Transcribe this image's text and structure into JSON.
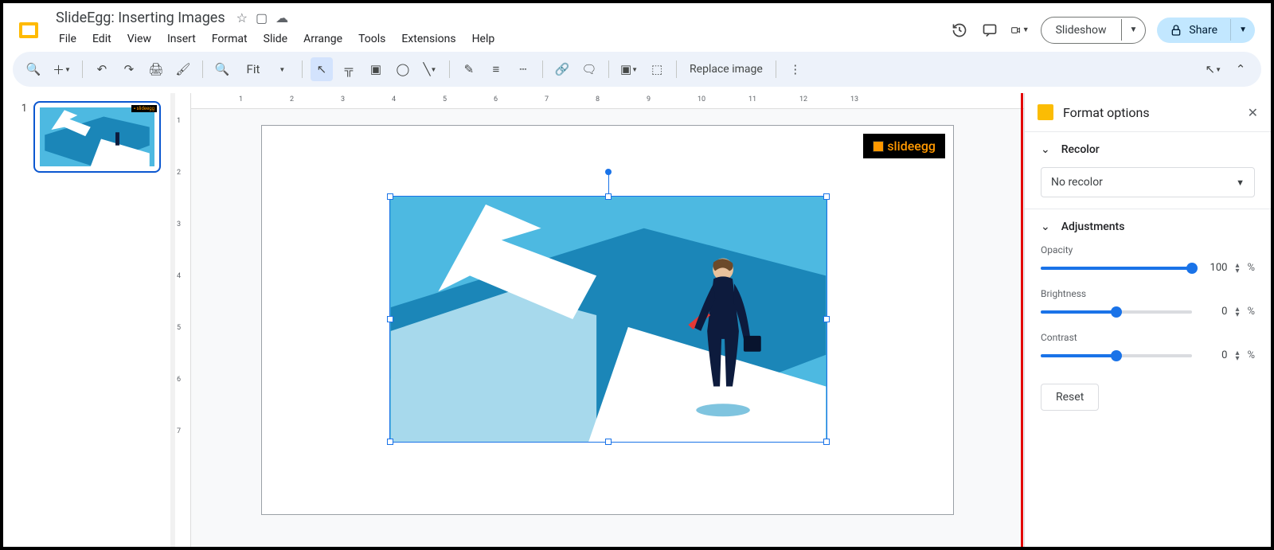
{
  "doc_title": "SlideEgg: Inserting Images",
  "menus": [
    "File",
    "Edit",
    "View",
    "Insert",
    "Format",
    "Slide",
    "Arrange",
    "Tools",
    "Extensions",
    "Help"
  ],
  "actions": {
    "slideshow": "Slideshow",
    "share": "Share"
  },
  "toolbar": {
    "zoom_label": "Fit",
    "replace_image": "Replace image"
  },
  "ruler_h": [
    "1",
    "2",
    "3",
    "4",
    "5",
    "6",
    "7",
    "8",
    "9",
    "10",
    "11",
    "12",
    "13"
  ],
  "ruler_v": [
    "1",
    "2",
    "3",
    "4",
    "5",
    "6",
    "7"
  ],
  "thumbs": [
    {
      "num": "1"
    }
  ],
  "slide": {
    "logo_text": "slideegg"
  },
  "sidebar": {
    "title": "Format options",
    "recolor": {
      "title": "Recolor",
      "value": "No recolor"
    },
    "adjustments": {
      "title": "Adjustments",
      "opacity": {
        "label": "Opacity",
        "value": "100",
        "pct": 100
      },
      "brightness": {
        "label": "Brightness",
        "value": "0",
        "pct": 50
      },
      "contrast": {
        "label": "Contrast",
        "value": "0",
        "pct": 50
      }
    },
    "reset": "Reset"
  }
}
